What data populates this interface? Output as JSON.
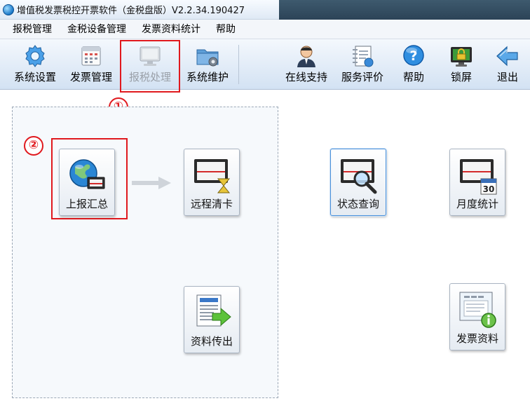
{
  "window": {
    "title": "增值税发票税控开票软件（金税盘版）V2.2.34.190427"
  },
  "menu": [
    "报税管理",
    "金税设备管理",
    "发票资料统计",
    "帮助"
  ],
  "toolbar_left": [
    {
      "label": "系统设置",
      "icon": "gear-icon"
    },
    {
      "label": "发票管理",
      "icon": "invoice-calendar-icon"
    },
    {
      "label": "报税处理",
      "icon": "monitor-icon",
      "state": "disabled"
    },
    {
      "label": "系统维护",
      "icon": "folder-gear-icon"
    }
  ],
  "toolbar_right": [
    {
      "label": "在线支持",
      "icon": "support-person-icon"
    },
    {
      "label": "服务评价",
      "icon": "notebook-icon"
    },
    {
      "label": "帮助",
      "icon": "help-question-icon"
    },
    {
      "label": "锁屏",
      "icon": "lock-screen-icon"
    },
    {
      "label": "退出",
      "icon": "exit-arrow-icon"
    }
  ],
  "annotations": {
    "step1": "①",
    "step2": "②"
  },
  "tiles": {
    "report_summary": "上报汇总",
    "remote_clear": "远程清卡",
    "data_transfer": "资料传出",
    "status_query": "状态查询",
    "monthly_stats": "月度统计",
    "invoice_data": "发票资料"
  },
  "calendar_day": "30",
  "colors": {
    "annotation_red": "#e0191e",
    "toolbar_top": "#f4f8fd",
    "toolbar_bottom": "#d3e2f3",
    "selected_border": "#4a90d9"
  }
}
